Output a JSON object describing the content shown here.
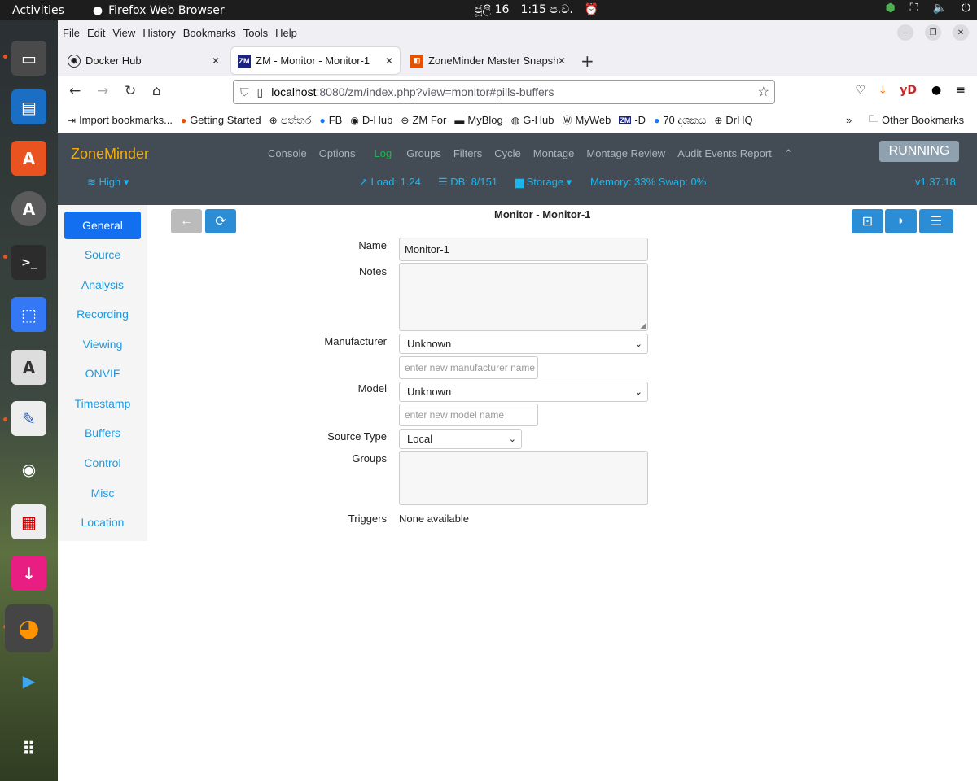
{
  "topbar": {
    "activities": "Activities",
    "app_name": "Firefox Web Browser",
    "date": "ජූලි 16",
    "time": "1:15 ප.ව."
  },
  "firefox": {
    "menu": [
      "File",
      "Edit",
      "View",
      "History",
      "Bookmarks",
      "Tools",
      "Help"
    ],
    "tabs": [
      {
        "title": "Docker Hub"
      },
      {
        "title": "ZM - Monitor - Monitor-1"
      },
      {
        "title": "ZoneMinder Master Snapsh"
      }
    ],
    "url_host": "localhost",
    "url_rest": ":8080/zm/index.php?view=monitor#pills-buffers",
    "bookmarks": [
      "Import bookmarks...",
      "Getting Started",
      "පත්තර",
      "FB",
      "D-Hub",
      "ZM For",
      "MyBlog",
      "G-Hub",
      "MyWeb",
      "-D",
      "70 දශකය",
      "DrHQ"
    ],
    "other_bookmarks": "Other Bookmarks"
  },
  "zm": {
    "logo": "ZoneMinder",
    "nav": [
      "Console",
      "Options",
      "Log",
      "Groups",
      "Filters",
      "Cycle",
      "Montage",
      "Montage Review",
      "Audit Events Report"
    ],
    "running": "RUNNING",
    "bandwidth": "High",
    "load": "Load: 1.24",
    "db": "DB: 8/151",
    "storage": "Storage",
    "memory": "Memory: 33% Swap: 0%",
    "version": "v1.37.18"
  },
  "sidebar": [
    "General",
    "Source",
    "Analysis",
    "Recording",
    "Viewing",
    "ONVIF",
    "Timestamp",
    "Buffers",
    "Control",
    "Misc",
    "Location"
  ],
  "form": {
    "title": "Monitor - Monitor-1",
    "name_label": "Name",
    "name_value": "Monitor-1",
    "notes_label": "Notes",
    "manufacturer_label": "Manufacturer",
    "manufacturer_value": "Unknown",
    "manufacturer_placeholder": "enter new manufacturer name",
    "model_label": "Model",
    "model_value": "Unknown",
    "model_placeholder": "enter new model name",
    "source_type_label": "Source Type",
    "source_type_value": "Local",
    "groups_label": "Groups",
    "triggers_label": "Triggers",
    "triggers_value": "None available"
  },
  "colors": {
    "zm_header": "#434c54",
    "zm_logo": "#f0ad0d",
    "active_pill": "#1270f0",
    "link": "#1f9ae0",
    "log_green": "#18b84a"
  }
}
